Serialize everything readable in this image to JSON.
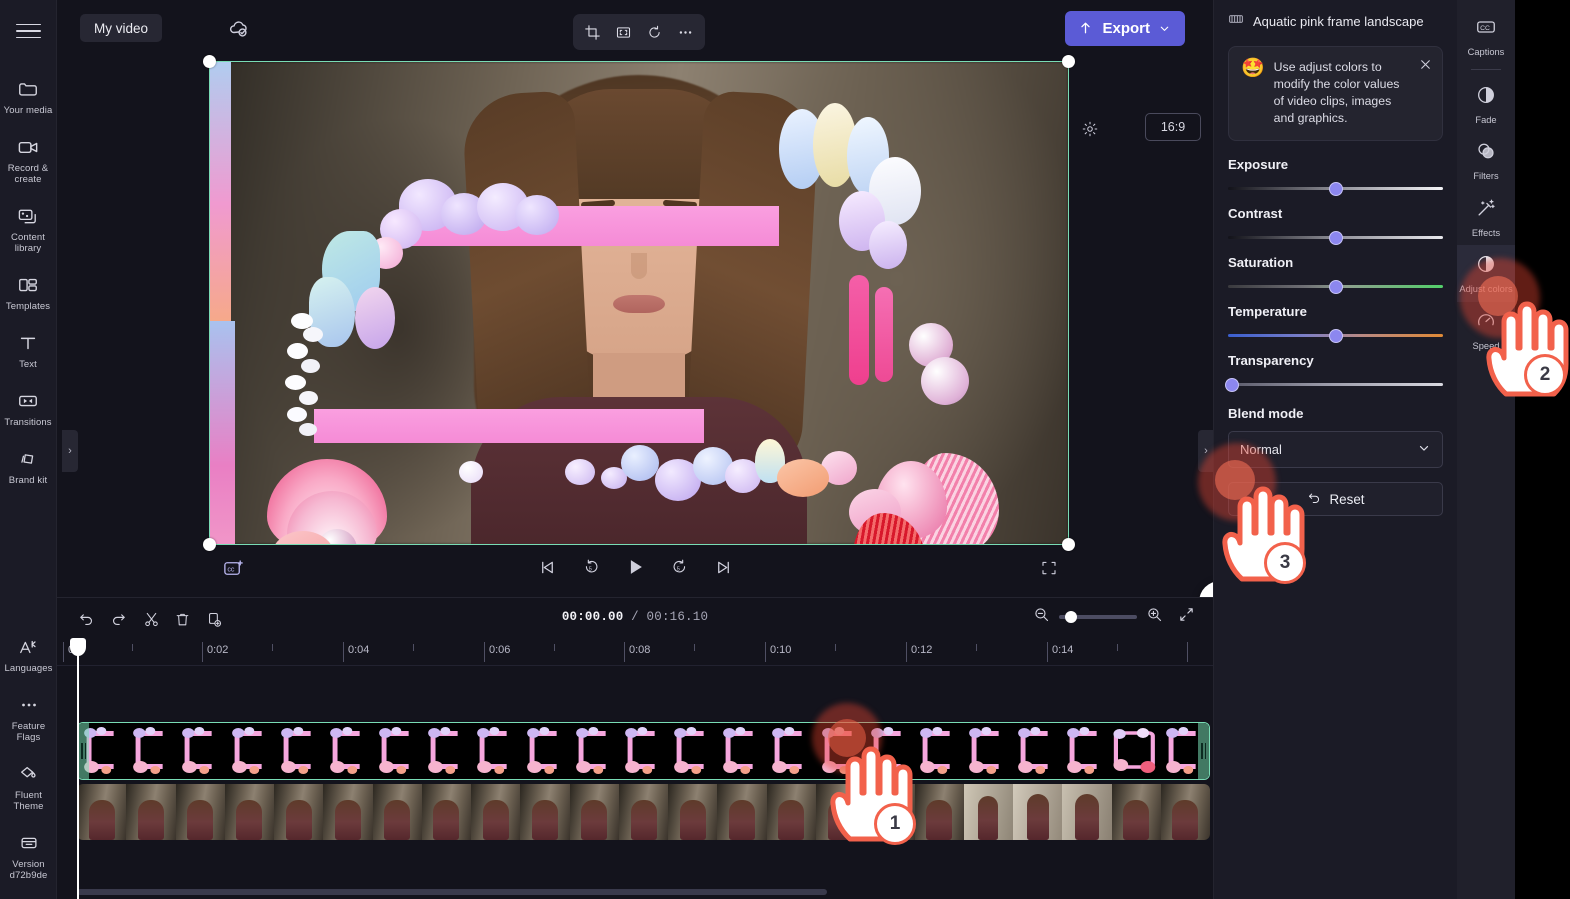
{
  "app": {
    "project_name": "My video",
    "export_label": "Export",
    "aspect_ratio": "16:9"
  },
  "left_sidebar": {
    "menu_icon": "hamburger-icon",
    "items": [
      {
        "label": "Your media",
        "icon": "folder-icon"
      },
      {
        "label": "Record & create",
        "icon": "video-camera-icon"
      },
      {
        "label": "Content library",
        "icon": "library-icon"
      },
      {
        "label": "Templates",
        "icon": "templates-icon"
      },
      {
        "label": "Text",
        "icon": "text-icon"
      },
      {
        "label": "Transitions",
        "icon": "transitions-icon"
      },
      {
        "label": "Brand kit",
        "icon": "brand-kit-icon"
      }
    ],
    "bottom_items": [
      {
        "label": "Languages",
        "icon": "languages-icon"
      },
      {
        "label": "Feature Flags",
        "icon": "ellipsis-icon"
      },
      {
        "label": "Fluent Theme",
        "icon": "theme-droplet-icon"
      },
      {
        "label": "Version d72b9de",
        "icon": "version-box-icon"
      }
    ]
  },
  "center_tools": [
    {
      "name": "crop-tool",
      "icon": "crop-icon"
    },
    {
      "name": "fit-tool",
      "icon": "fit-frame-icon"
    },
    {
      "name": "rotate-tool",
      "icon": "rotate-icon"
    },
    {
      "name": "more-tool",
      "icon": "ellipsis-icon"
    }
  ],
  "player": {
    "cc_button": "cc-plus-icon",
    "skip_back": "skip-to-start-icon",
    "rewind_5": "rewind-5-icon",
    "play": "play-icon",
    "forward_5": "forward-5-icon",
    "skip_forward": "skip-to-end-icon",
    "fullscreen": "fullscreen-icon",
    "help": "?"
  },
  "timeline": {
    "toolbar": [
      {
        "name": "undo-button",
        "icon": "undo-icon"
      },
      {
        "name": "redo-button",
        "icon": "redo-icon"
      },
      {
        "name": "split-button",
        "icon": "scissors-icon"
      },
      {
        "name": "delete-button",
        "icon": "trash-icon"
      },
      {
        "name": "duplicate-button",
        "icon": "duplicate-icon"
      }
    ],
    "current_time": "00:00.00",
    "separator": "/",
    "total_time": "00:16.10",
    "zoom_out_icon": "zoom-out-icon",
    "zoom_in_icon": "zoom-in-icon",
    "fit-icon": "fit-timeline-icon",
    "ruler_labels": [
      "0",
      "0:02",
      "0:04",
      "0:06",
      "0:08",
      "0:10",
      "0:12",
      "0:14"
    ],
    "tracks": [
      {
        "name": "overlay-track",
        "selected": true
      },
      {
        "name": "video-track",
        "selected": false
      }
    ]
  },
  "right_panel": {
    "clip_title": "Aquatic pink frame landscape",
    "clip_icon": "film-strip-icon",
    "tip": {
      "emoji": "🤩",
      "text": "Use adjust colors to modify the color values of video clips, images and graphics.",
      "close_icon": "close-icon"
    },
    "sliders": [
      {
        "label": "Exposure",
        "value_pct": 50,
        "track": "t-exposure"
      },
      {
        "label": "Contrast",
        "value_pct": 50,
        "track": "t-contrast"
      },
      {
        "label": "Saturation",
        "value_pct": 50,
        "track": "t-saturation"
      },
      {
        "label": "Temperature",
        "value_pct": 50,
        "track": "t-temperature"
      },
      {
        "label": "Transparency",
        "value_pct": 2,
        "track": "t-transparency"
      }
    ],
    "blend_mode_label": "Blend mode",
    "blend_mode_value": "Normal",
    "chevron_icon": "chevron-down-icon",
    "reset_label": "Reset",
    "reset_icon": "undo-arrow-icon"
  },
  "right_rail": {
    "items": [
      {
        "label": "Captions",
        "icon": "cc-icon",
        "active": false
      },
      {
        "label": "Fade",
        "icon": "fade-icon",
        "active": false
      },
      {
        "label": "Filters",
        "icon": "filters-icon",
        "active": false
      },
      {
        "label": "Effects",
        "icon": "effects-wand-icon",
        "active": false
      },
      {
        "label": "Adjust colors",
        "icon": "adjust-colors-icon",
        "active": true
      },
      {
        "label": "Speed",
        "icon": "speed-icon",
        "active": false
      }
    ]
  },
  "annotations": {
    "steps": [
      {
        "number": "1",
        "target": "timeline-overlay-clip"
      },
      {
        "number": "2",
        "target": "adjust-colors-rail-item"
      },
      {
        "number": "3",
        "target": "transparency-slider"
      }
    ]
  },
  "colors": {
    "accent": "#5b5bd6",
    "selection": "#79dcb5",
    "annotation": "#f2614b",
    "knob": "#8c87ef",
    "panel_bg": "#1b1b26",
    "app_bg": "#13131c"
  }
}
